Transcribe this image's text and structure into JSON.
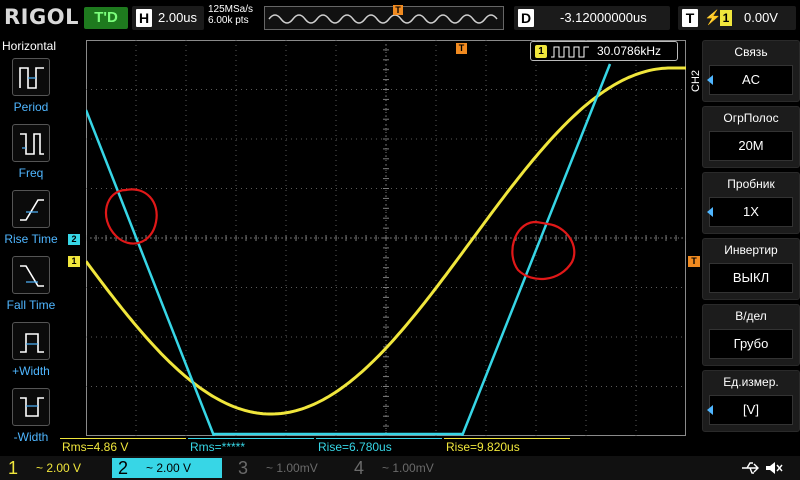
{
  "brand": "RIGOL",
  "top": {
    "run_state": "T'D",
    "horizontal_key": "H",
    "timebase": "2.00us",
    "sample_rate": "125MSa/s",
    "mem_depth": "6.00k pts",
    "delay_key": "D",
    "delay": "-3.12000000us",
    "trigger_key": "T",
    "trigger_source": "1",
    "trigger_level": "0.00V",
    "trigger_marker": "T"
  },
  "left_menu": {
    "title": "Horizontal",
    "items": [
      {
        "label": "Period",
        "icon": "period-icon"
      },
      {
        "label": "Freq",
        "icon": "frequency-icon"
      },
      {
        "label": "Rise Time",
        "icon": "rise-time-icon"
      },
      {
        "label": "Fall Time",
        "icon": "fall-time-icon"
      },
      {
        "label": "+Width",
        "icon": "positive-width-icon"
      },
      {
        "label": "-Width",
        "icon": "negative-width-icon"
      }
    ]
  },
  "right_menu": {
    "channel_tag": "CH2",
    "items": [
      {
        "label": "Связь",
        "value": "AC",
        "has_arrow": true
      },
      {
        "label": "ОгрПолос",
        "value": "20M",
        "has_arrow": false
      },
      {
        "label": "Пробник",
        "value": "1X",
        "has_arrow": true
      },
      {
        "label": "Инвертир",
        "value": "ВЫКЛ",
        "has_arrow": false
      },
      {
        "label": "В/дел",
        "value": "Грубо",
        "has_arrow": false
      },
      {
        "label": "Ед.измер.",
        "value": "[V]",
        "has_arrow": true
      }
    ]
  },
  "freq_counter": {
    "channel": "1",
    "value": "30.0786kHz"
  },
  "screen": {
    "ch1_marker": "1",
    "ch2_marker": "2",
    "trigger_marker": "T"
  },
  "measurements": [
    {
      "text": "Rms=4.86 V",
      "channel": 1
    },
    {
      "text": "Rms=*****",
      "channel": 2
    },
    {
      "text": "Rise=6.780us",
      "channel": 2
    },
    {
      "text": "Rise=9.820us",
      "channel": 1
    }
  ],
  "channels": [
    {
      "num": "1",
      "setting": "~ 2.00 V",
      "color": "#f0e63c",
      "active": false
    },
    {
      "num": "2",
      "setting": "~ 2.00 V",
      "color": "#37d6e6",
      "active": true
    },
    {
      "num": "3",
      "setting": "~ 1.00mV",
      "color": "#6a6a6a",
      "active": false
    },
    {
      "num": "4",
      "setting": "~ 1.00mV",
      "color": "#6a6a6a",
      "active": false
    }
  ],
  "colors": {
    "ch1": "#f0e63c",
    "ch2": "#37d6e6",
    "trigger": "#f08a20",
    "grid": "#5a5a5a",
    "annotation": "#e01818"
  }
}
